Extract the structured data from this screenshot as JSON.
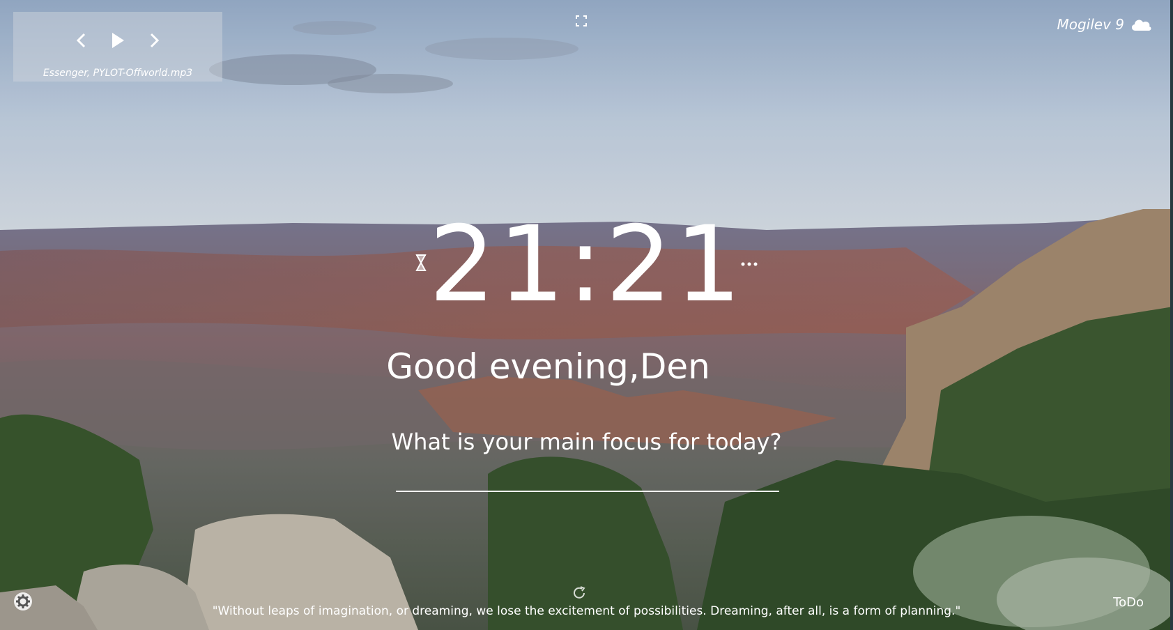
{
  "player": {
    "track": "Essenger, PYLOT-Offworld.mp3",
    "prev_icon": "chevron-left-icon",
    "play_icon": "play-icon",
    "next_icon": "chevron-right-icon"
  },
  "weather": {
    "city_temp": "Mogilev 9",
    "icon": "cloud-icon"
  },
  "clock": {
    "time": "21:21"
  },
  "greeting": {
    "text": "Good evening,",
    "name": "Den"
  },
  "focus": {
    "question": "What is your main focus for today?",
    "value": ""
  },
  "quote": {
    "text": "\"Without leaps of imagination, or dreaming, we lose the excitement of possibilities. Dreaming, after all, is a form of planning.\""
  },
  "footer": {
    "todo_label": "ToDo"
  },
  "colors": {
    "text": "#ffffff",
    "player_bg": "rgba(210,214,222,0.45)"
  }
}
